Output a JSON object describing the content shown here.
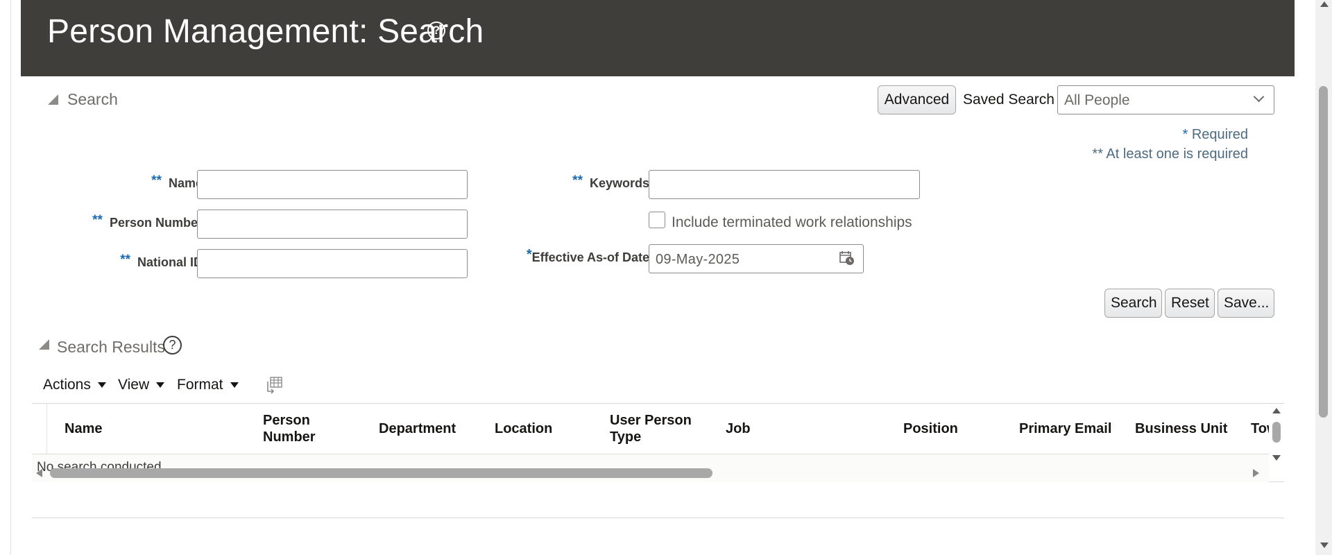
{
  "header": {
    "title": "Person Management: Search",
    "help_icon": "question-circle-icon"
  },
  "search": {
    "section_label": "Search",
    "advanced_label": "Advanced",
    "saved_search_label": "Saved Search",
    "saved_search_value": "All People",
    "required_note": "Required",
    "required_star": "*",
    "at_least_one_note": "** At least one is required",
    "fields": {
      "name": {
        "stars": "**",
        "label": "Name",
        "value": ""
      },
      "person_number": {
        "stars": "**",
        "label": "Person Number",
        "value": ""
      },
      "national_id": {
        "stars": "**",
        "label": "National ID",
        "value": ""
      },
      "keywords": {
        "stars": "**",
        "label": "Keywords",
        "value": ""
      },
      "include_terminated": {
        "label": "Include terminated work relationships",
        "checked": false
      },
      "effective_date": {
        "star": "*",
        "label": "Effective As-of Date",
        "value": "09-May-2025"
      }
    },
    "buttons": {
      "search": "Search",
      "reset": "Reset",
      "save": "Save..."
    }
  },
  "results": {
    "section_label": "Search Results",
    "toolbar": {
      "actions": "Actions",
      "view": "View",
      "format": "Format"
    },
    "columns": [
      [
        "Name"
      ],
      [
        "Person",
        "Number"
      ],
      [
        "Department"
      ],
      [
        "Location"
      ],
      [
        "User Person",
        "Type"
      ],
      [
        "Job"
      ],
      [
        "Position"
      ],
      [
        "Primary Email"
      ],
      [
        "Business Unit"
      ],
      [
        "Tow"
      ]
    ],
    "empty_message": "No search conducted."
  },
  "colors": {
    "header_bg": "#3f3e3b",
    "required_star": "#1b6ab0",
    "required_text": "#4d6b80"
  }
}
